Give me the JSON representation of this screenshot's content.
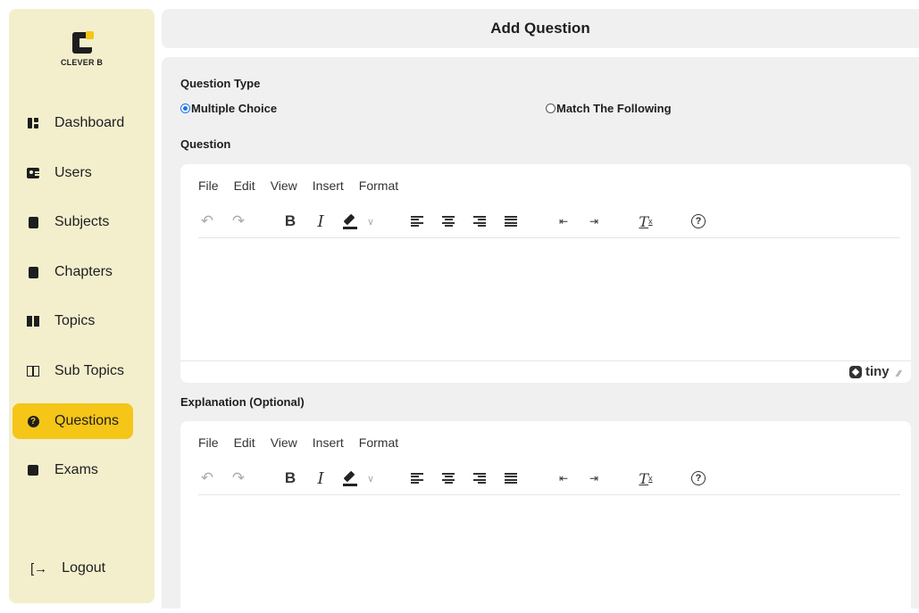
{
  "app": {
    "logo_text": "CLEVER B"
  },
  "sidebar": {
    "items": [
      {
        "label": "Dashboard",
        "icon": "dashboard-icon"
      },
      {
        "label": "Users",
        "icon": "users-icon"
      },
      {
        "label": "Subjects",
        "icon": "subjects-icon"
      },
      {
        "label": "Chapters",
        "icon": "chapters-icon"
      },
      {
        "label": "Topics",
        "icon": "topics-icon"
      },
      {
        "label": "Sub Topics",
        "icon": "sub-topics-icon"
      },
      {
        "label": "Questions",
        "icon": "questions-icon",
        "active": true
      },
      {
        "label": "Exams",
        "icon": "exams-icon"
      }
    ],
    "logout_label": "Logout",
    "active_color": "#f5c518",
    "background_color": "#f3efcd"
  },
  "header": {
    "title": "Add Question"
  },
  "form": {
    "question_type_label": "Question Type",
    "options": [
      {
        "label": "Multiple Choice",
        "selected": true
      },
      {
        "label": "Match The Following",
        "selected": false
      }
    ],
    "question_label": "Question",
    "explanation_label": "Explanation (Optional)"
  },
  "editor": {
    "menu": [
      "File",
      "Edit",
      "View",
      "Insert",
      "Format"
    ],
    "branding": "tiny",
    "toolbar_icons": [
      "undo-icon",
      "redo-icon",
      "bold-icon",
      "italic-icon",
      "highlight-icon",
      "chevron-down-icon",
      "align-left-icon",
      "align-center-icon",
      "align-right-icon",
      "align-justify-icon",
      "outdent-icon",
      "indent-icon",
      "clear-formatting-icon",
      "help-icon"
    ]
  }
}
